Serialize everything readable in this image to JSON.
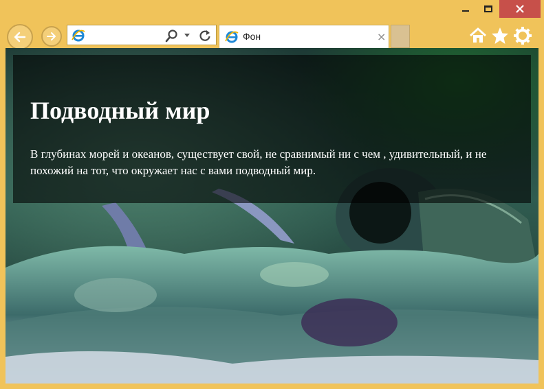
{
  "window": {
    "tab_title": "Фон",
    "address_value": ""
  },
  "icons": {
    "back": "back-arrow-icon",
    "forward": "forward-arrow-icon",
    "search": "search-icon",
    "dropdown": "chevron-down-icon",
    "refresh": "refresh-icon",
    "ie": "ie-logo-icon",
    "home": "home-icon",
    "favorites": "star-icon",
    "settings": "gear-icon",
    "tab_close": "×"
  },
  "page": {
    "heading": "Подводный мир",
    "paragraph": "В глубинах морей и океанов, существует свой, не сравнимый ни с чем , удивительный, и не похожий на тот, что окружает нас с вами подводный мир."
  },
  "colors": {
    "frame": "#f0c35a",
    "close_button": "#c7504a",
    "overlay": "rgba(0,0,0,0.58)",
    "text": "#ffffff"
  }
}
